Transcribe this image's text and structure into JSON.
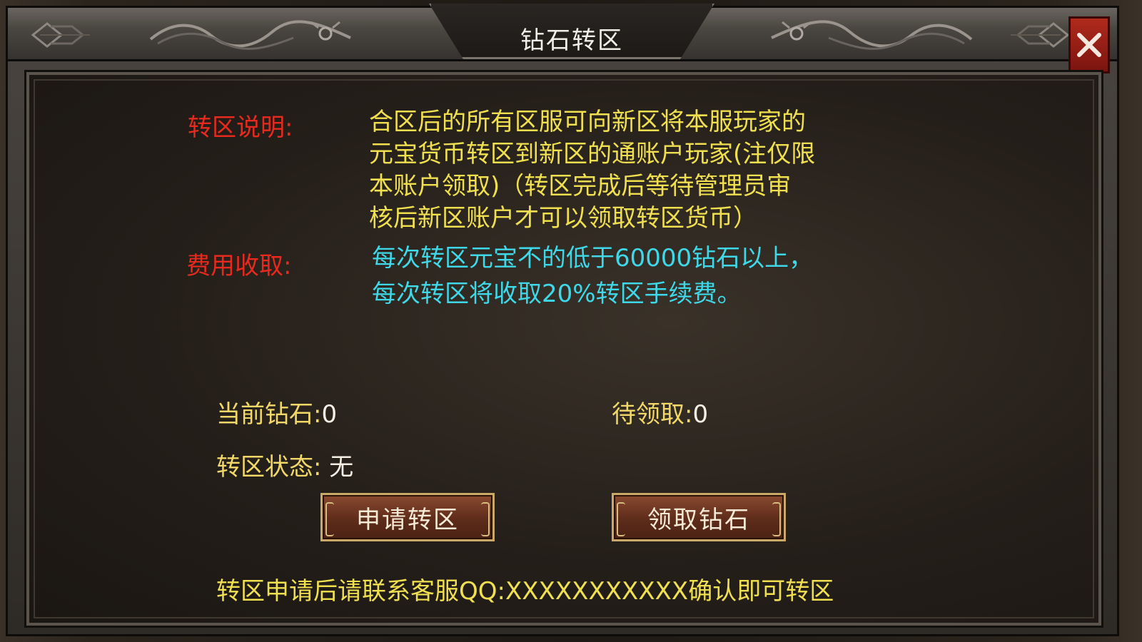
{
  "window": {
    "title": "钻石转区"
  },
  "info": {
    "transfer_label": "转区说明:",
    "transfer_lines": [
      "合区后的所有区服可向新区将本服玩家的",
      "元宝货币转区到新区的通账户玩家(注仅限",
      "本账户领取)（转区完成后等待管理员审",
      "核后新区账户才可以领取转区货币）"
    ],
    "fee_label": "费用收取:",
    "fee_lines": [
      "每次转区元宝不的低于60000钻石以上，",
      "每次转区将收取20%转区手续费。"
    ]
  },
  "stats": {
    "current_diamonds_label": "当前钻石:",
    "current_diamonds_value": "0",
    "pending_label": "待领取:",
    "pending_value": "0",
    "status_label": "转区状态:",
    "status_value": "无"
  },
  "buttons": {
    "apply_label": "申请转区",
    "claim_label": "领取钻石"
  },
  "footer": {
    "note": "转区申请后请联系客服QQ:XXXXXXXXXXX确认即可转区"
  },
  "colors": {
    "label_red": "#e82a1e",
    "text_yellow": "#f0e050",
    "text_cyan": "#3ed8e8",
    "close_red": "#b02a1c"
  },
  "icons": {
    "close": "close-icon",
    "dragon_ornament": "dragon-ornament-icon",
    "knot_ornament": "knot-ornament-icon"
  }
}
